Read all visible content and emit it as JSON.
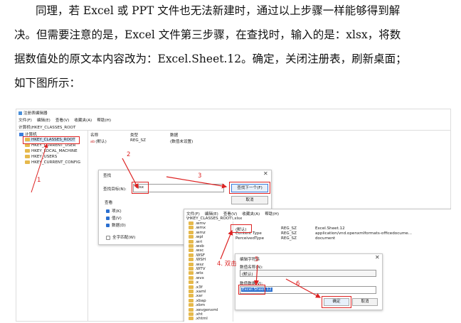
{
  "paragraph": {
    "lines": [
      "同理，若 Excel 或 PPT 文件也无法新建时，通过以上步骤一样能够得到解",
      "决。但需要注意的是，Excel 文件第三步骤，在查找时，输入的是：xlsx，将数",
      "据数值处的原文本内容改为：Excel.Sheet.12。确定，关闭注册表，刷新桌面；",
      "如下图所示："
    ]
  },
  "figure": {
    "regedit": {
      "title": "注册表编辑器",
      "menu": [
        "文件(F)",
        "编辑(E)",
        "查看(V)",
        "收藏夹(A)",
        "帮助(H)"
      ],
      "address": "计算机\\HKEY_CLASSES_ROOT",
      "tree_root": "计算机",
      "tree": [
        "HKEY_CLASSES_ROOT",
        "HKEY_CURRENT_USER",
        "HKEY_LOCAL_MACHINE",
        "HKEY_USERS",
        "HKEY_CURRENT_CONFIG"
      ],
      "columns": [
        "名称",
        "类型",
        "数据"
      ],
      "default_row": [
        "(默认)",
        "REG_SZ",
        "(数值未设置)"
      ]
    },
    "find_dialog": {
      "title": "查找",
      "target_label": "查找目标(N):",
      "target_value": "xlsx",
      "find_next": "查找下一个(F)",
      "cancel": "取消",
      "look_at": "查看",
      "options": [
        {
          "label": "项(K)",
          "checked": true
        },
        {
          "label": "值(V)",
          "checked": true
        },
        {
          "label": "数据(D)",
          "checked": true
        }
      ],
      "match_whole": "全字匹配(W)"
    },
    "regedit2": {
      "menu": [
        "文件(F)",
        "编辑(E)",
        "查看(V)",
        "收藏夹(A)",
        "帮助(H)"
      ],
      "address": "\\HKEY_CLASSES_ROOT\\.xlsx",
      "tree": [
        ".wmv",
        ".wmx",
        ".wmz",
        ".wpl",
        ".wri",
        ".wsb",
        ".wsc",
        ".WSF",
        ".WSH",
        ".wsz",
        ".WTV",
        ".wtx",
        ".wvx",
        ".x",
        ".x3f",
        ".xaml",
        ".xar",
        ".xbap",
        ".xbm",
        ".xevgenxml",
        ".xht",
        ".xhtml"
      ],
      "rows": [
        [
          "(默认)",
          "REG_SZ",
          "Excel.Sheet.12"
        ],
        [
          "Content Type",
          "REG_SZ",
          "application/vnd.openxmlformats-officedocume..."
        ],
        [
          "PerceivedType",
          "REG_SZ",
          "document"
        ]
      ]
    },
    "edit_dialog": {
      "title": "编辑字符串",
      "name_label": "数值名称(N):",
      "name_value": "(默认)",
      "data_label": "数值数据(V):",
      "data_value": "Excel.Sheet.12",
      "ok": "确定",
      "cancel": "取消"
    },
    "annotations": [
      "1",
      "2",
      "3",
      "4. 双击",
      "5",
      "6"
    ]
  },
  "colors": {
    "annotation_red": "#d22222",
    "selection_blue": "#cde4f7",
    "folder_yellow": "#e6b94c"
  }
}
